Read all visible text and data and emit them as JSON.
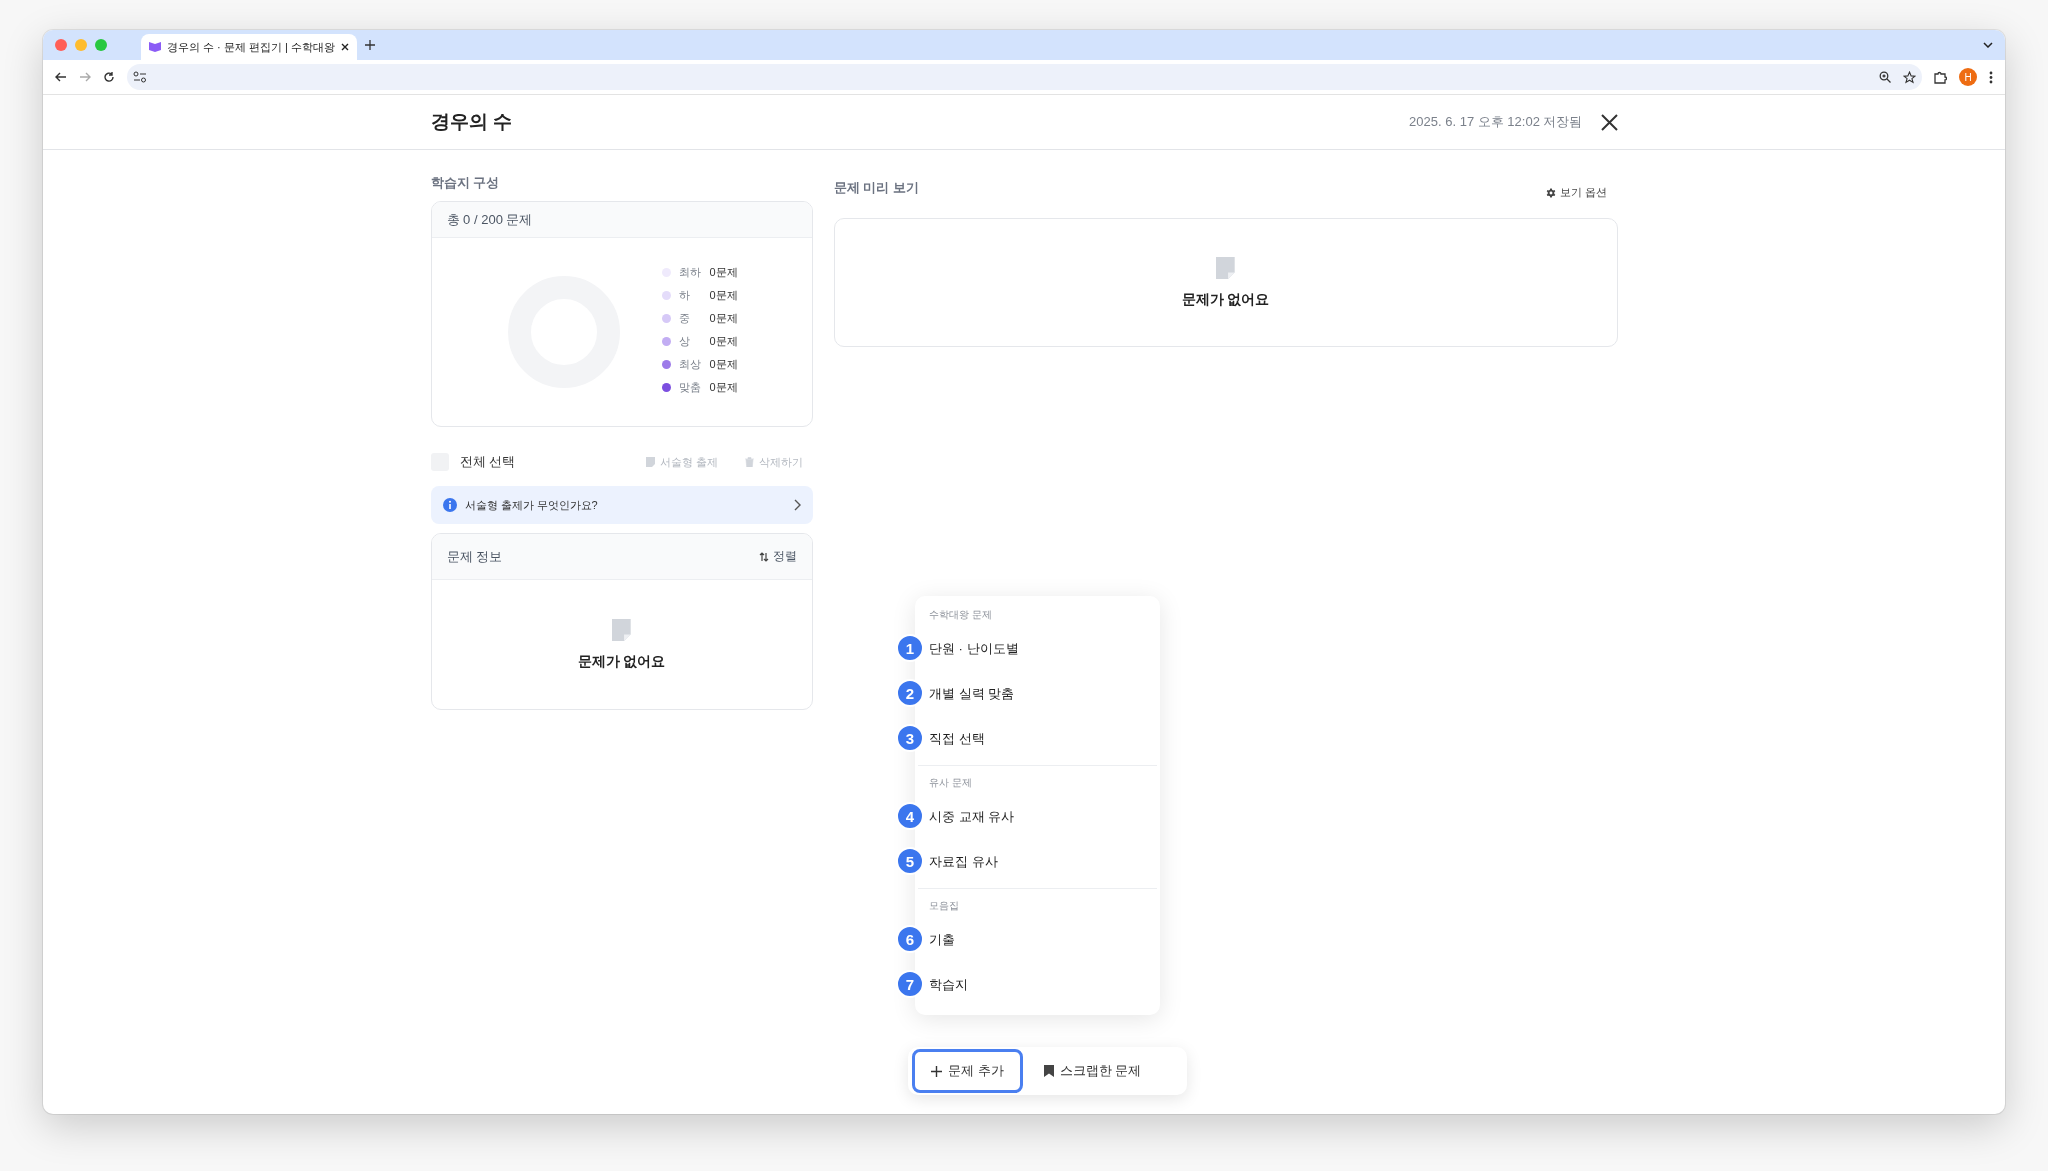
{
  "browser": {
    "tab_title": "경우의 수 · 문제 편집기 | 수학대왕",
    "profile_initial": "H"
  },
  "header": {
    "title": "경우의 수",
    "saved_at": "2025. 6. 17 오후 12:02 저장됨"
  },
  "composition": {
    "label": "학습지 구성",
    "total": "총 0 / 200 문제",
    "legend": [
      {
        "name": "최하",
        "count": "0문제",
        "color": "#efeafc"
      },
      {
        "name": "하",
        "count": "0문제",
        "color": "#e4dcfa"
      },
      {
        "name": "중",
        "count": "0문제",
        "color": "#d6c9f7"
      },
      {
        "name": "상",
        "count": "0문제",
        "color": "#c2adf3"
      },
      {
        "name": "최상",
        "count": "0문제",
        "color": "#9d7be9"
      },
      {
        "name": "맞춤",
        "count": "0문제",
        "color": "#7c4fe0"
      }
    ]
  },
  "selection": {
    "select_all": "전체 선택",
    "checked": false,
    "actions": [
      {
        "label": "서술형 출제",
        "kind": "essay",
        "disabled": true
      },
      {
        "label": "삭제하기",
        "kind": "delete",
        "disabled": true
      }
    ]
  },
  "info_banner": {
    "text": "서술형 출제가 무엇인가요?"
  },
  "problem_info": {
    "title": "문제 정보",
    "sort": "정렬",
    "empty": "문제가 없어요"
  },
  "preview": {
    "title": "문제 미리 보기",
    "options": "보기 옵션",
    "empty": "문제가 없어요"
  },
  "add_menu": {
    "groups": [
      {
        "heading": "수학대왕 문제",
        "items": [
          {
            "number": "1",
            "label": "단원 · 난이도별"
          },
          {
            "number": "2",
            "label": "개별 실력 맞춤"
          },
          {
            "number": "3",
            "label": "직접 선택"
          }
        ]
      },
      {
        "heading": "유사 문제",
        "items": [
          {
            "number": "4",
            "label": "시중 교재 유사"
          },
          {
            "number": "5",
            "label": "자료집 유사"
          }
        ]
      },
      {
        "heading": "모음집",
        "items": [
          {
            "number": "6",
            "label": "기출"
          },
          {
            "number": "7",
            "label": "학습지"
          }
        ]
      }
    ]
  },
  "bottom_bar": {
    "buttons": [
      {
        "label": "문제 추가",
        "kind": "add",
        "selected": true
      },
      {
        "label": "스크랩한 문제",
        "kind": "scrap",
        "selected": false
      }
    ]
  }
}
